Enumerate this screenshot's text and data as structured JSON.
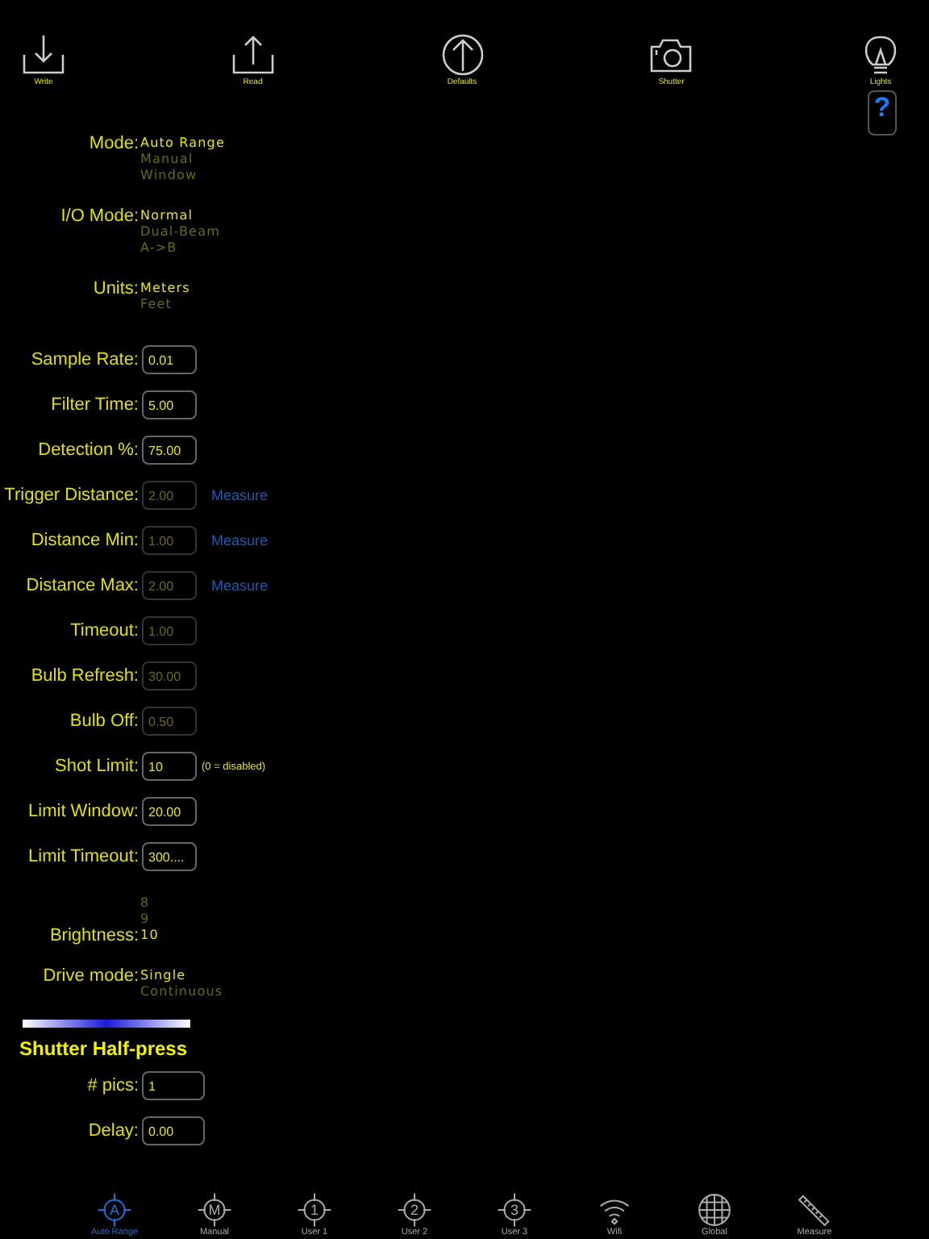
{
  "toolbar": [
    {
      "label": "Write"
    },
    {
      "label": "Read"
    },
    {
      "label": "Defaults"
    },
    {
      "label": "Shutter"
    },
    {
      "label": "Lights"
    }
  ],
  "help_button": {
    "label": "?"
  },
  "settings": [
    {
      "kind": "picker",
      "label": "Mode:",
      "options": [
        {
          "text": "Auto Range",
          "selected": true
        },
        {
          "text": "Manual",
          "selected": false
        },
        {
          "text": "Window",
          "selected": false
        }
      ]
    },
    {
      "kind": "picker",
      "label": "I/O Mode:",
      "options": [
        {
          "text": "Normal",
          "selected": true
        },
        {
          "text": "Dual-Beam",
          "selected": false
        },
        {
          "text": "A->B",
          "selected": false
        }
      ]
    },
    {
      "kind": "picker",
      "label": "Units:",
      "options": [
        {
          "text": "Meters",
          "selected": true
        },
        {
          "text": "Feet",
          "selected": false
        }
      ]
    },
    {
      "kind": "field",
      "label": "Sample Rate:",
      "value": "0.01",
      "disabled": false
    },
    {
      "kind": "field",
      "label": "Filter Time:",
      "value": "5.00",
      "disabled": false
    },
    {
      "kind": "field",
      "label": "Detection %:",
      "value": "75.00",
      "disabled": false
    },
    {
      "kind": "field",
      "label": "Trigger Distance:",
      "value": "2.00",
      "disabled": true,
      "link": "Measure"
    },
    {
      "kind": "field",
      "label": "Distance Min:",
      "value": "1.00",
      "disabled": true,
      "link": "Measure"
    },
    {
      "kind": "field",
      "label": "Distance Max:",
      "value": "2.00",
      "disabled": true,
      "link": "Measure"
    },
    {
      "kind": "field",
      "label": "Timeout:",
      "value": "1.00",
      "disabled": true
    },
    {
      "kind": "field",
      "label": "Bulb Refresh:",
      "value": "30.00",
      "disabled": true
    },
    {
      "kind": "field",
      "label": "Bulb Off:",
      "value": "0.50",
      "disabled": true
    },
    {
      "kind": "field",
      "label": "Shot Limit:",
      "value": "10",
      "disabled": false,
      "note": "(0 = disabled)"
    },
    {
      "kind": "field",
      "label": "Limit Window:",
      "value": "20.00",
      "disabled": false
    },
    {
      "kind": "field",
      "label": "Limit Timeout:",
      "value": "300....",
      "disabled": false
    },
    {
      "kind": "picker",
      "label": "Brightness:",
      "options": [
        {
          "text": "8",
          "selected": false
        },
        {
          "text": "9",
          "selected": false
        },
        {
          "text": "10",
          "selected": true
        }
      ]
    },
    {
      "kind": "picker",
      "label": "Drive mode:",
      "options": [
        {
          "text": "Single",
          "selected": true
        },
        {
          "text": "Continuous",
          "selected": false
        }
      ]
    }
  ],
  "section": {
    "title": "Shutter Half-press",
    "fields": [
      {
        "label": "# pics:",
        "value": "1",
        "disabled": false
      },
      {
        "label": "Delay:",
        "value": "0.00",
        "disabled": false
      }
    ]
  },
  "tabs": [
    {
      "label": "Auto Range",
      "glyph": "A",
      "selected": true
    },
    {
      "label": "Manual",
      "glyph": "M",
      "selected": false
    },
    {
      "label": "User 1",
      "glyph": "1",
      "selected": false
    },
    {
      "label": "User 2",
      "glyph": "2",
      "selected": false
    },
    {
      "label": "User 3",
      "glyph": "3",
      "selected": false
    },
    {
      "label": "Wifi",
      "selected": false
    },
    {
      "label": "Global",
      "selected": false
    },
    {
      "label": "Measure",
      "selected": false
    }
  ]
}
